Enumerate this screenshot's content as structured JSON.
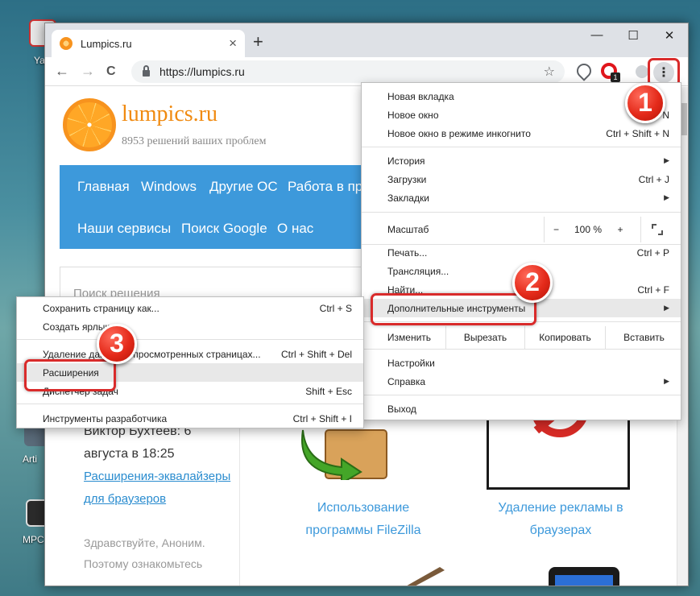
{
  "desktop": {
    "icon_labels": [
      "Ya",
      "Arti",
      "MPC"
    ]
  },
  "tab": {
    "title": "Lumpics.ru",
    "close": "×"
  },
  "new_tab": "+",
  "window_controls": {
    "minimize": "—",
    "maximize": "☐",
    "close": "✕"
  },
  "toolbar": {
    "back": "←",
    "forward": "→",
    "reload": "C",
    "url": "https://lumpics.ru",
    "star": "☆",
    "ext_badge": "1",
    "menu_dots": "⋮"
  },
  "site": {
    "title": "lumpics.ru",
    "subtitle": "8953 решений ваших проблем",
    "nav": [
      "Главная",
      "Windows",
      "Другие ОС",
      "Работа в про",
      "Наши сервисы",
      "Поиск Google",
      "О нас"
    ],
    "search_placeholder": "Поиск решения",
    "comment_author": "Виктор Бухтеев: 6 августа в 18:25",
    "comment_link": "Расширения-эквалайзеры для браузеров",
    "comment_text1": "Здравствуйте, Аноним.",
    "comment_text2": "Поэтому ознакомьтесь",
    "card1": "Использование программы FileZilla",
    "card2": "Удаление рекламы в браузерах"
  },
  "main_menu": {
    "new_tab": "Новая вкладка",
    "new_window": "Новое окно",
    "new_window_sc": "Ctrl + N",
    "incognito": "Новое окно в режиме инкогнито",
    "incognito_sc": "Ctrl + Shift + N",
    "history": "История",
    "downloads": "Загрузки",
    "downloads_sc": "Ctrl + J",
    "bookmarks": "Закладки",
    "zoom_label": "Масштаб",
    "zoom_minus": "−",
    "zoom_value": "100 %",
    "zoom_plus": "+",
    "print": "Печать...",
    "print_sc": "Ctrl + P",
    "cast": "Трансляция...",
    "find": "Найти...",
    "find_sc": "Ctrl + F",
    "more_tools": "Дополнительные инструменты",
    "edit": "Изменить",
    "cut": "Вырезать",
    "copy": "Копировать",
    "paste": "Вставить",
    "settings": "Настройки",
    "help": "Справка",
    "exit": "Выход",
    "arrow": "▶"
  },
  "submenu": {
    "save_page": "Сохранить страницу как...",
    "save_page_sc": "Ctrl + S",
    "shortcut": "Создать ярлык...",
    "clear_data": "Удаление данных о просмотренных страницах...",
    "clear_data_sc": "Ctrl + Shift + Del",
    "extensions": "Расширения",
    "task_manager": "Диспетчер задач",
    "task_manager_sc": "Shift + Esc",
    "dev_tools": "Инструменты разработчика",
    "dev_tools_sc": "Ctrl + Shift + I"
  },
  "annotations": {
    "step1": "1",
    "step2": "2",
    "step3": "3"
  },
  "colors": {
    "accent_red": "#d92b2b",
    "site_blue": "#3d99db",
    "brand_orange": "#f7931e"
  }
}
